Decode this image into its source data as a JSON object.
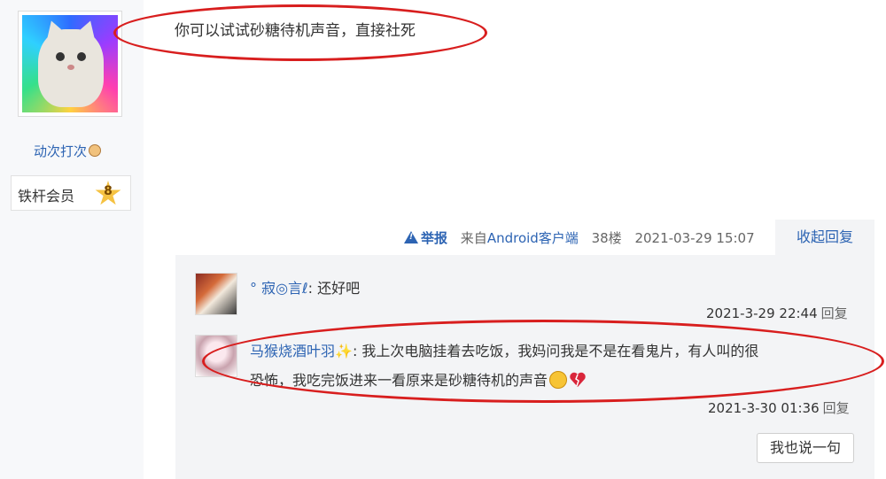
{
  "user": {
    "name": "动次打次",
    "member_title": "铁杆会员",
    "level": "8"
  },
  "post": {
    "text": "你可以试试砂糖待机声音，直接社死"
  },
  "meta": {
    "report": "举报",
    "source_prefix": "来自",
    "client": "Android客户端",
    "floor": "38楼",
    "timestamp": "2021-03-29 15:07",
    "collapse": "收起回复"
  },
  "replies": [
    {
      "user": "° 寂◎言ℓ",
      "text": ": 还好吧",
      "time": "2021-3-29 22:44",
      "reply_label": "回复"
    },
    {
      "user": "马猴烧酒叶羽✨",
      "line1": ": 我上次电脑挂着去吃饭，我妈问我是不是在看鬼片，有人叫的很",
      "line2": "恐怖，我吃完饭进来一看原来是砂糖待机的声音",
      "time": "2021-3-30 01:36",
      "reply_label": "回复"
    }
  ],
  "reply_button": "我也说一句",
  "colors": {
    "link": "#2d64b3",
    "annotation": "#d81e1e"
  }
}
